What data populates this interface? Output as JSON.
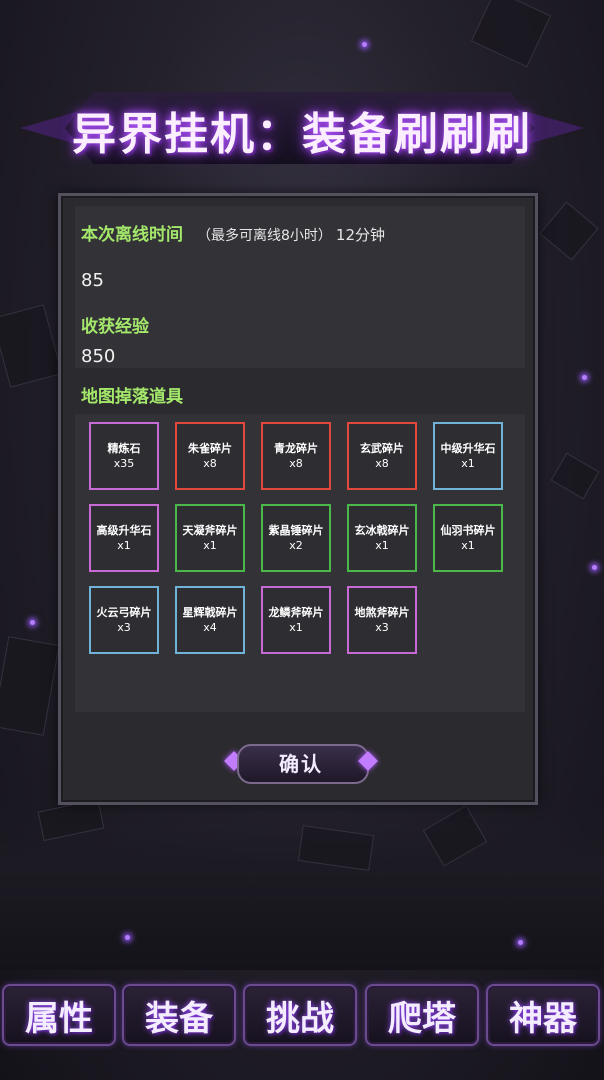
{
  "title": "异界挂机：装备刷刷刷",
  "offline": {
    "label": "本次离线时间",
    "note": "（最多可离线8小时）",
    "duration": "12分钟",
    "value": "85",
    "exp_label": "收获经验",
    "exp_value": "850"
  },
  "drops": {
    "label": "地图掉落道具",
    "items": [
      {
        "name": "精炼石",
        "count": "x35",
        "color": "#c86ad6"
      },
      {
        "name": "朱雀碎片",
        "count": "x8",
        "color": "#e2483c"
      },
      {
        "name": "青龙碎片",
        "count": "x8",
        "color": "#e2483c"
      },
      {
        "name": "玄武碎片",
        "count": "x8",
        "color": "#e2483c"
      },
      {
        "name": "中级升华石",
        "count": "x1",
        "color": "#6fb3d8"
      },
      {
        "name": "高级升华石",
        "count": "x1",
        "color": "#c86ad6"
      },
      {
        "name": "天凝斧碎片",
        "count": "x1",
        "color": "#4cb84c"
      },
      {
        "name": "紫晶锤碎片",
        "count": "x2",
        "color": "#4cb84c"
      },
      {
        "name": "玄冰戟碎片",
        "count": "x1",
        "color": "#4cb84c"
      },
      {
        "name": "仙羽书碎片",
        "count": "x1",
        "color": "#4cb84c"
      },
      {
        "name": "火云弓碎片",
        "count": "x3",
        "color": "#6fb3d8"
      },
      {
        "name": "星辉戟碎片",
        "count": "x4",
        "color": "#6fb3d8"
      },
      {
        "name": "龙鳞斧碎片",
        "count": "x1",
        "color": "#c86ad6"
      },
      {
        "name": "地煞斧碎片",
        "count": "x3",
        "color": "#c86ad6"
      }
    ]
  },
  "confirm_label": "确认",
  "nav": {
    "attributes": "属性",
    "equipment": "装备",
    "challenge": "挑战",
    "tower": "爬塔",
    "artifact": "神器"
  }
}
